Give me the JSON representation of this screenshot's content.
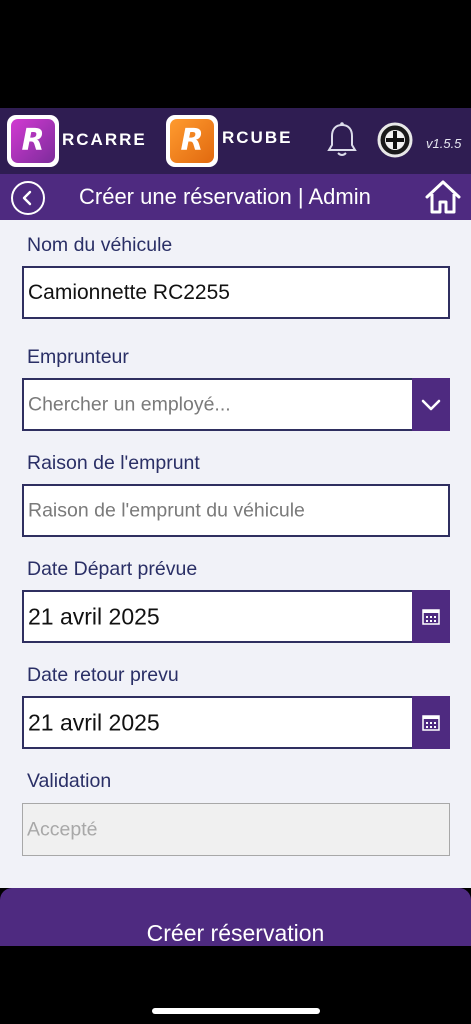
{
  "header": {
    "brand_left": "RCARRE",
    "brand_right": "RCUBE",
    "logo_letter": "R",
    "version": "v1.5.5",
    "icons": [
      "bell-icon",
      "powered-icon"
    ]
  },
  "titlebar": {
    "title": "Créer une réservation | Admin",
    "icons": [
      "back-icon",
      "home-icon"
    ]
  },
  "form": {
    "vehicle": {
      "label": "Nom du véhicule",
      "value": "Camionnette RC2255"
    },
    "borrower": {
      "label": "Emprunteur",
      "placeholder": "Chercher un employé...",
      "icon": "chevron-down-icon"
    },
    "reason": {
      "label": "Raison de l'emprunt",
      "placeholder": "Raison de l'emprunt du véhicule"
    },
    "departure": {
      "label": "Date Départ prévue",
      "value": "21 avril 2025",
      "icon": "calendar-icon"
    },
    "return": {
      "label": "Date retour prevu",
      "value": "21 avril 2025",
      "icon": "calendar-icon"
    },
    "validation": {
      "label": "Validation",
      "placeholder": "Accepté"
    }
  },
  "actions": {
    "create_label": "Créer réservation"
  },
  "colors": {
    "header": "#2f1d52",
    "titlebar": "#4e2a80",
    "accent": "#4e2a80",
    "background": "#f1f2f8",
    "label": "#2a2f66"
  }
}
